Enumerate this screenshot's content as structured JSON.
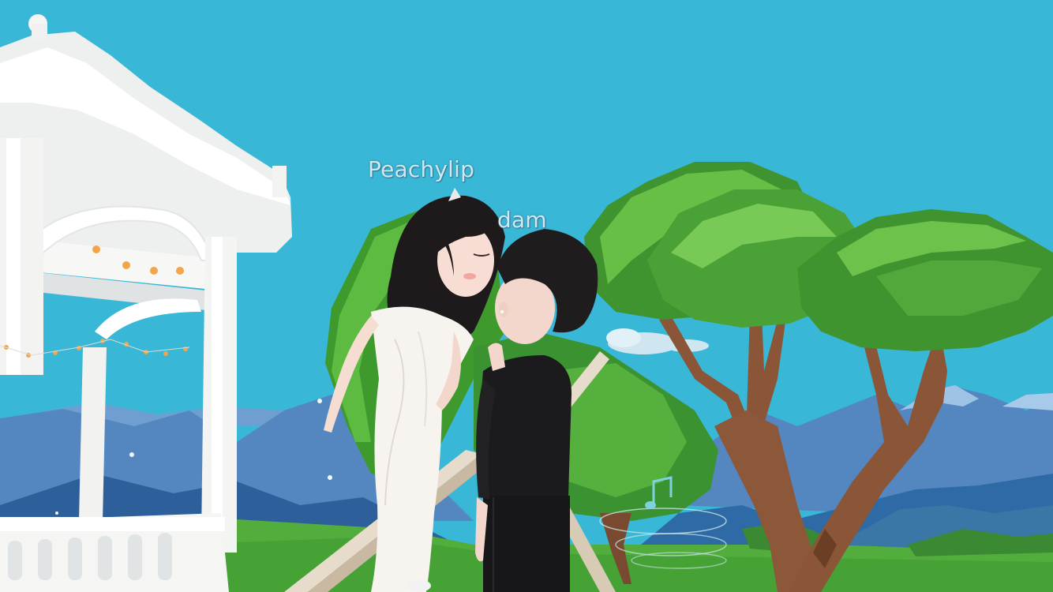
{
  "players": [
    {
      "name": "Peachylip",
      "role": "bride"
    },
    {
      "name": "dam",
      "role": "groom"
    }
  ],
  "colors": {
    "sky": "#38b8d6",
    "grass": "#4fa83a",
    "mountain": "#4f80b8",
    "tree_foliage": "#4d9f36",
    "trunk": "#8a5637",
    "gazebo": "#f4f4f2",
    "dress": "#f7f4ef",
    "suit": "#1b1b1d"
  }
}
